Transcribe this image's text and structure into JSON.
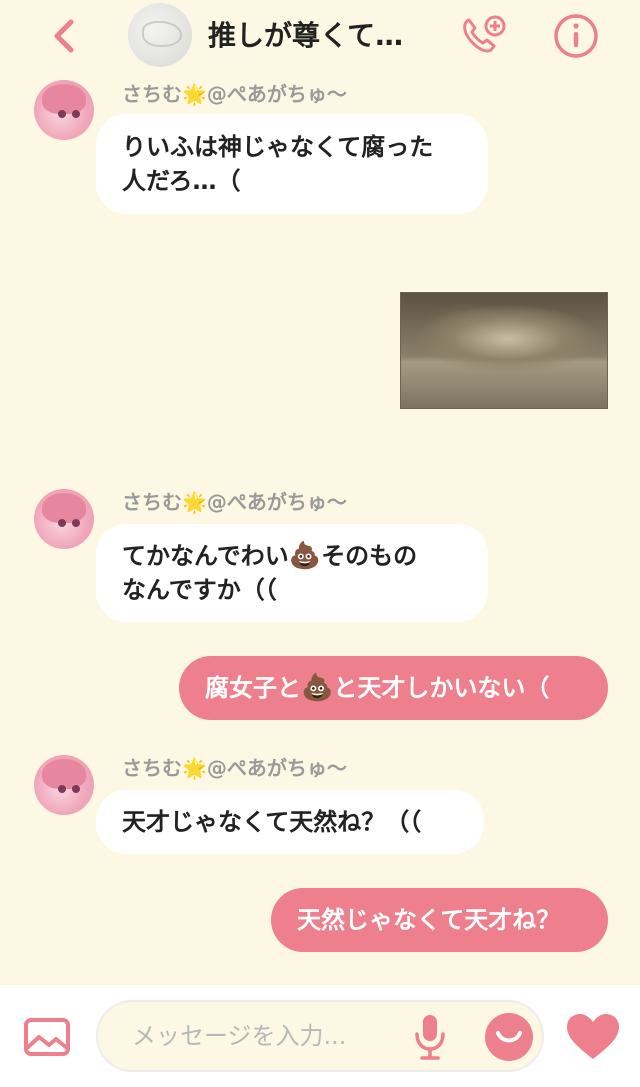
{
  "header": {
    "title": "推しが尊くて…",
    "back_icon": "chevron-left-icon",
    "call_icon": "phone-add-icon",
    "info_icon": "info-icon"
  },
  "colors": {
    "background": "#fdf8e4",
    "accent": "#ee7f8d",
    "bubble_in": "#ffffff",
    "text": "#222222",
    "meta": "#9a9a9a"
  },
  "messages": [
    {
      "direction": "in",
      "sender": "さちむ",
      "star": "🌟",
      "sender_suffix": "@ぺあがちゅ～",
      "lines": [
        "りいふは神じゃなくて腐った",
        "人だろ…（"
      ]
    },
    {
      "direction": "out",
      "type": "image"
    },
    {
      "direction": "in",
      "sender": "さちむ",
      "star": "🌟",
      "sender_suffix": "@ぺあがちゅ～",
      "lines": [
        "てかなんでわい",
        "💩",
        "そのもの",
        "なんですか（（"
      ]
    },
    {
      "direction": "out",
      "parts": [
        "腐女子と",
        "💩",
        "と天才しかいない（"
      ]
    },
    {
      "direction": "in",
      "sender": "さちむ",
      "star": "🌟",
      "sender_suffix": "@ぺあがちゅ～",
      "lines": [
        "天才じゃなくて天然ね？（（"
      ]
    },
    {
      "direction": "out",
      "text": "天然じゃなくて天才ね？"
    }
  ],
  "footer": {
    "placeholder": "メッセージを入力...",
    "image_icon": "image-icon",
    "mic_icon": "microphone-icon",
    "sticker_icon": "smiley-icon",
    "like_icon": "heart-icon"
  }
}
